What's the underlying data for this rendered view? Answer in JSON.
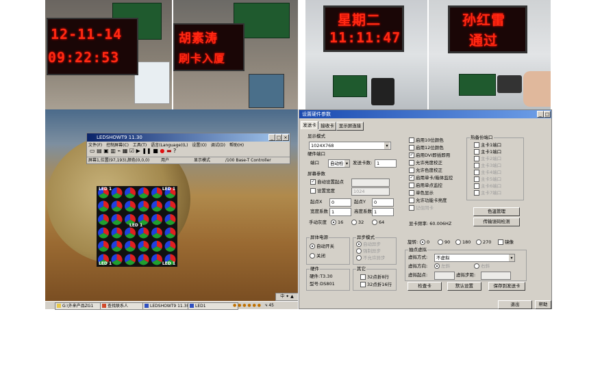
{
  "photos": {
    "p1": {
      "line1": "12-11-14",
      "line2": "09:22:53"
    },
    "p2": {
      "line1": "胡素涛",
      "line2": "刷卡入厦"
    },
    "p3": {
      "line1": "星期二",
      "line2": "11:11:47"
    },
    "p4": {
      "line1": "孙红雷",
      "line2": "通过"
    }
  },
  "led_window": {
    "title": "LEDSHOWT9 11.30",
    "menu": [
      "文件(F)",
      "控制屏幕(C)",
      "工具(T)",
      "语言(Language)(L)",
      "设置(O)",
      "调试(D)",
      "帮助(H)"
    ],
    "status": {
      "position": "屏幕1,位置(97,193),颜色(0,0,0)",
      "user": "用户",
      "display": "显示模式",
      "controller": "/100 Base-T Controller"
    },
    "led_labels": {
      "tl": "LED 1",
      "tr": "LED 1",
      "center": "LED 1",
      "bl": "LED 1",
      "br": "LED 1"
    }
  },
  "taskbar": {
    "item1": "G:\\外来产品ZG1",
    "item2": "查找联系人",
    "item3": "LEDSHOWT9 11.30",
    "item4": "LED1",
    "tray": "中 ✦ ▲",
    "right_trim": "ч 45"
  },
  "settings": {
    "title": "设置硬件参数",
    "tabs": [
      "发送卡",
      "接收卡",
      "显示屏连接"
    ],
    "display_mode": {
      "label": "显示模式",
      "value": "1024X768"
    },
    "hw_port": {
      "label": "硬件端口",
      "port_label": "端口",
      "port_value": "自动检",
      "send_count_label": "发送卡数:",
      "send_count_value": "1"
    },
    "screen_params": {
      "label": "屏幕参数",
      "auto_start": "自动设置起点",
      "set_width": "设置宽度",
      "width_value": "1024",
      "start_x_label": "起点X",
      "start_x_value": "0",
      "start_y_label": "起点Y",
      "start_y_value": "0",
      "width_coef_label": "宽度系数",
      "width_coef_value": "1",
      "height_coef_label": "高度系数",
      "height_coef_value": "1",
      "gray_label": "手动灰度",
      "gray_options": [
        "16",
        "32",
        "64"
      ]
    },
    "power": {
      "label": "屏体电源",
      "on": "自动开关",
      "off": "关闭"
    },
    "async": {
      "label": "异步模式",
      "options": [
        "自动异步",
        "强制异步",
        "不允许异步"
      ]
    },
    "hardware": {
      "label": "硬件",
      "version": "硬件:T3.30",
      "model": "型号:DS801"
    },
    "other": {
      "label": "其它",
      "opt1": "32点折8行",
      "opt2": "32点折16行"
    },
    "checks": [
      {
        "text": "启用10位颜色",
        "checked": false,
        "disabled": false
      },
      {
        "text": "启用12位颜色",
        "checked": false,
        "disabled": false
      },
      {
        "text": "启用DVI即插即用",
        "checked": true,
        "disabled": false
      },
      {
        "text": "允许亮度校正",
        "checked": false,
        "disabled": false
      },
      {
        "text": "允许色度校正",
        "checked": false,
        "disabled": false
      },
      {
        "text": "启用单卡/箱体监控",
        "checked": true,
        "disabled": false
      },
      {
        "text": "启用单点监控",
        "checked": false,
        "disabled": false
      },
      {
        "text": "单色显示",
        "checked": false,
        "disabled": false
      },
      {
        "text": "允许功能卡亮度",
        "checked": false,
        "disabled": false
      },
      {
        "text": "记住同卡",
        "checked": false,
        "disabled": true
      }
    ],
    "card_freq": "显卡频率: 60.006HZ",
    "hot_backup": {
      "label": "热备份端口",
      "items": [
        {
          "text": "主卡1端口",
          "disabled": false
        },
        {
          "text": "主卡1端口",
          "disabled": false
        },
        {
          "text": "主卡2端口",
          "disabled": true
        },
        {
          "text": "主卡3端口",
          "disabled": true
        },
        {
          "text": "主卡4端口",
          "disabled": true
        },
        {
          "text": "主卡5端口",
          "disabled": true
        },
        {
          "text": "主卡6端口",
          "disabled": true
        },
        {
          "text": "主卡7端口",
          "disabled": true
        }
      ]
    },
    "color_mgmt": "色温管理",
    "transfer_check": "传输误码检测",
    "rotation": {
      "label": "旋转:",
      "options": [
        "0",
        "90",
        "180",
        "270"
      ],
      "mirror": "镜像"
    },
    "virtual": {
      "label": "抽点虚拟",
      "mode_label": "虚拟方式:",
      "mode_value": "不虚拟",
      "dir_label": "虚拟方向:",
      "dir_opt1": "左斜",
      "dir_opt2": "右斜",
      "start_label": "虚拟起点:",
      "step_label": "虚拟步距:"
    },
    "buttons": {
      "check_card": "检查卡",
      "default": "默认设置",
      "save": "保存到发送卡",
      "exit": "退出",
      "help": "帮助"
    }
  }
}
